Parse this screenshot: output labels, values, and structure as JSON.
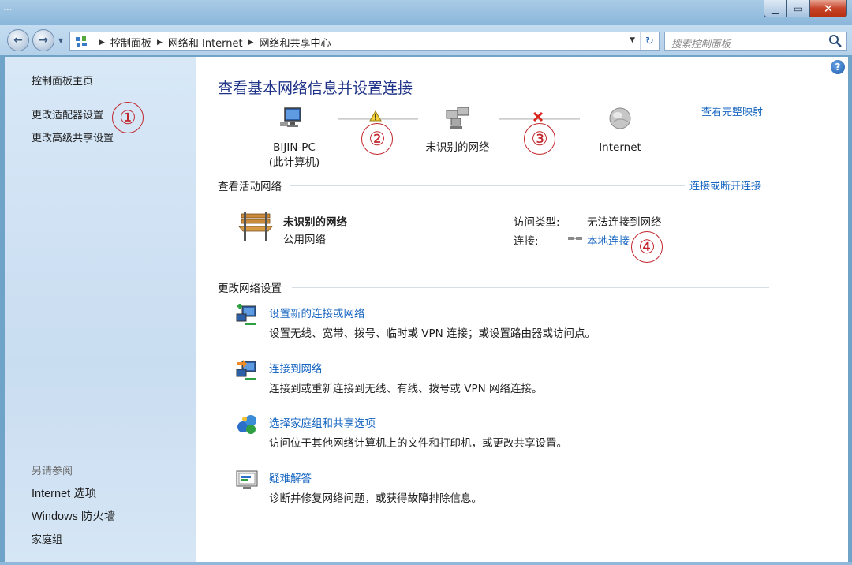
{
  "window": {
    "app_name": "..."
  },
  "address_bar": {
    "crumbs": [
      "控制面板",
      "网络和 Internet",
      "网络和共享中心"
    ]
  },
  "search": {
    "placeholder": "搜索控制面板"
  },
  "left_pane": {
    "home": "控制面板主页",
    "adapter_settings": "更改适配器设置",
    "advanced_sharing": "更改高级共享设置",
    "see_also": "另请参阅",
    "internet_options": "Internet 选项",
    "firewall": "Windows 防火墙",
    "homegroup": "家庭组"
  },
  "main": {
    "title": "查看基本网络信息并设置连接",
    "full_map": "查看完整映射",
    "map": {
      "computer_name": "BIJIN-PC",
      "computer_sub": "(此计算机)",
      "network": "未识别的网络",
      "internet": "Internet"
    },
    "active_header": "查看活动网络",
    "connect_disconnect": "连接或断开连接",
    "active": {
      "name": "未识别的网络",
      "type": "公用网络",
      "access_label": "访问类型:",
      "access_value": "无法连接到网络",
      "conn_label": "连接:",
      "conn_value": "本地连接"
    },
    "change_header": "更改网络设置",
    "tasks": [
      {
        "title": "设置新的连接或网络",
        "desc": "设置无线、宽带、拨号、临时或 VPN 连接；或设置路由器或访问点。"
      },
      {
        "title": "连接到网络",
        "desc": "连接到或重新连接到无线、有线、拨号或 VPN 网络连接。"
      },
      {
        "title": "选择家庭组和共享选项",
        "desc": "访问位于其他网络计算机上的文件和打印机，或更改共享设置。"
      },
      {
        "title": "疑难解答",
        "desc": "诊断并修复网络问题，或获得故障排除信息。"
      }
    ]
  },
  "annotations": [
    "①",
    "②",
    "③",
    "④"
  ],
  "colors": {
    "link": "#1565c0",
    "title": "#1e3287",
    "annotation": "#c1272d",
    "left_pane": "#d2e3f4"
  },
  "icons": [
    "back-arrow-icon",
    "forward-arrow-icon",
    "control-panel-icon",
    "refresh-icon",
    "search-icon",
    "help-icon",
    "computer-icon",
    "warning-icon",
    "network-icon",
    "error-x-icon",
    "globe-icon",
    "bench-icon",
    "network-connection-icon",
    "new-connection-icon",
    "connect-network-icon",
    "homegroup-icon",
    "troubleshoot-icon"
  ]
}
